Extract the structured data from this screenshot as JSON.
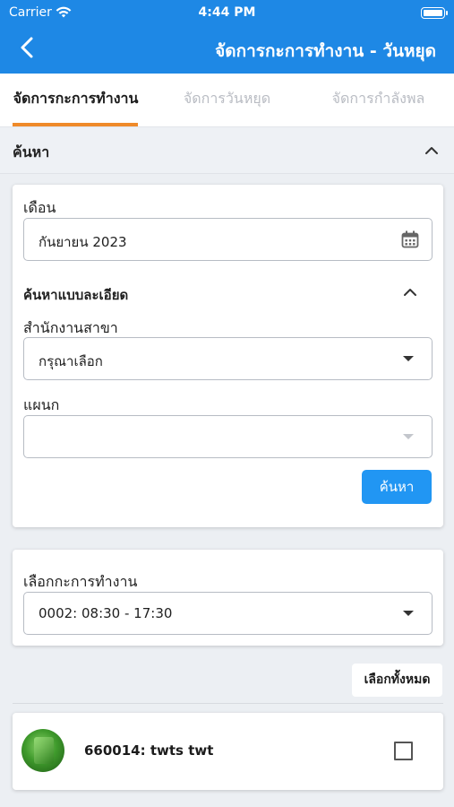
{
  "status_bar": {
    "carrier": "Carrier",
    "time": "4:44 PM"
  },
  "nav": {
    "title": "จัดการกะการทำงาน - วันหยุด"
  },
  "tabs": [
    {
      "label": "จัดการกะการทำงาน",
      "active": true
    },
    {
      "label": "จัดการวันหยุด",
      "active": false
    },
    {
      "label": "จัดการกำลังพล",
      "active": false
    }
  ],
  "search": {
    "section_label": "ค้นหา",
    "month_label": "เดือน",
    "month_value": "กันยายน 2023",
    "advanced_label": "ค้นหาแบบละเอียด",
    "branch_label": "สำนักงานสาขา",
    "branch_value": "กรุณาเลือก",
    "department_label": "แผนก",
    "department_value": "",
    "search_button": "ค้นหา"
  },
  "shift": {
    "label": "เลือกกะการทำงาน",
    "value": "0002: 08:30 - 17:30"
  },
  "select_all_button": "เลือกทั้งหมด",
  "employees": [
    {
      "name": "660014: twts twt",
      "checked": false
    }
  ],
  "colors": {
    "primary": "#1e88e5",
    "button": "#2196f3",
    "tab_indicator": "#ef8a2a"
  },
  "icons": {
    "back": "chevron-left-icon",
    "calendar": "calendar-icon",
    "collapse": "chevron-up-icon",
    "dropdown": "caret-down-icon",
    "wifi": "wifi-icon",
    "battery": "battery-icon"
  }
}
